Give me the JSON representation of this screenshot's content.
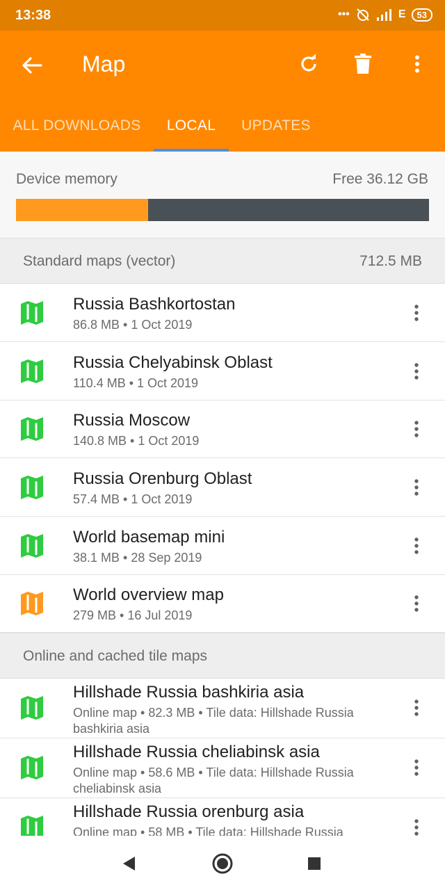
{
  "status_bar": {
    "time": "13:38",
    "signal_text": "E",
    "battery": "53"
  },
  "app_bar": {
    "title": "Map"
  },
  "tabs": [
    {
      "label": "ALL DOWNLOADS"
    },
    {
      "label": "LOCAL",
      "active": true
    },
    {
      "label": "UPDATES"
    }
  ],
  "memory": {
    "label": "Device memory",
    "free": "Free 36.12 GB",
    "used_fraction": 0.32
  },
  "sections": [
    {
      "title": "Standard maps (vector)",
      "size": "712.5 MB",
      "items": [
        {
          "name": "Russia Bashkortostan",
          "desc": "86.8 MB • 1 Oct 2019",
          "icon": "map-icon",
          "icon_color": "#2ecc40"
        },
        {
          "name": "Russia Chelyabinsk Oblast",
          "desc": "110.4 MB • 1 Oct 2019",
          "icon": "map-icon",
          "icon_color": "#2ecc40"
        },
        {
          "name": "Russia Moscow",
          "desc": "140.8 MB • 1 Oct 2019",
          "icon": "map-icon",
          "icon_color": "#2ecc40"
        },
        {
          "name": "Russia Orenburg Oblast",
          "desc": "57.4 MB • 1 Oct 2019",
          "icon": "map-icon",
          "icon_color": "#2ecc40"
        },
        {
          "name": "World basemap mini",
          "desc": "38.1 MB • 28 Sep 2019",
          "icon": "map-icon",
          "icon_color": "#2ecc40"
        },
        {
          "name": "World overview map",
          "desc": "279 MB • 16 Jul 2019",
          "icon": "map-icon",
          "icon_color": "#ff9a1f"
        }
      ]
    },
    {
      "title": "Online and cached tile maps",
      "items": [
        {
          "name": "Hillshade Russia bashkiria asia",
          "desc": "Online map • 82.3 MB • Tile data: Hillshade Russia bashkiria asia",
          "icon": "map-icon",
          "icon_color": "#2ecc40"
        },
        {
          "name": "Hillshade Russia cheliabinsk asia",
          "desc": "Online map • 58.6 MB • Tile data: Hillshade Russia cheliabinsk asia",
          "icon": "map-icon",
          "icon_color": "#2ecc40"
        },
        {
          "name": "Hillshade Russia orenburg asia",
          "desc": "Online map • 58 MB • Tile data: Hillshade Russia",
          "icon": "map-icon",
          "icon_color": "#2ecc40"
        }
      ]
    }
  ],
  "icons": {
    "back": "arrow-left-icon",
    "refresh": "refresh-icon",
    "delete": "trash-icon",
    "more": "more-vertical-icon",
    "nav_back": "triangle-back-icon",
    "nav_home": "circle-home-icon",
    "nav_recent": "square-recent-icon"
  },
  "colors": {
    "status_bar": "#e07f00",
    "app_bar": "#ff8800",
    "tab_indicator": "#4a90e2",
    "memory_used": "#ff9a1f",
    "memory_free": "#4a5156"
  }
}
